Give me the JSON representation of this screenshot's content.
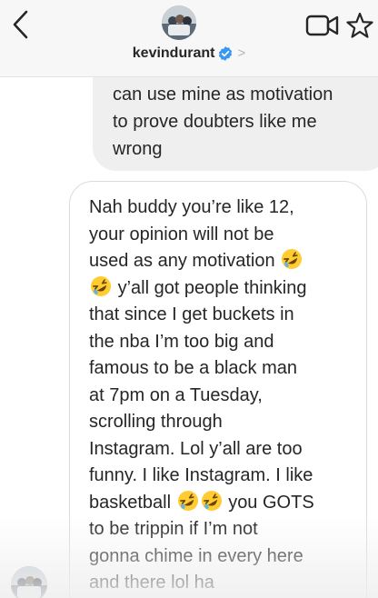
{
  "header": {
    "username": "kevindurant",
    "verified": true,
    "icons": {
      "back": "chevron-left-icon",
      "verified": "verified-badge-icon",
      "profile_chevron": "chevron-right-icon",
      "video": "video-camera-icon",
      "star": "star-icon"
    }
  },
  "chev_glyph": ">",
  "messages": [
    {
      "direction": "outgoing",
      "text": "can use mine as motivation\nto prove doubters like me\nwrong"
    },
    {
      "direction": "incoming",
      "lines": [
        "Nah buddy you’re like 12,",
        "your opinion will not be",
        "used as any motivation",
        "y’all got people thinking",
        "that since I get buckets in",
        "the nba I’m too big and",
        "famous to be a black man",
        "at 7pm on a Tuesday,",
        "scrolling through",
        "Instagram. Lol y’all are too",
        "funny. I like Instagram. I like",
        "basketball",
        "you GOTS",
        "to be trippin if I’m not",
        "gonna chime in every here",
        "and there lol ha"
      ],
      "emoji": "rolling-on-the-floor-laughing-emoji"
    }
  ],
  "colors": {
    "header_bg": "#f7f7f7",
    "outgoing_bubble": "#efefef",
    "incoming_border": "#dbdbdb",
    "text": "#262626",
    "verified_blue": "#3897f0"
  }
}
